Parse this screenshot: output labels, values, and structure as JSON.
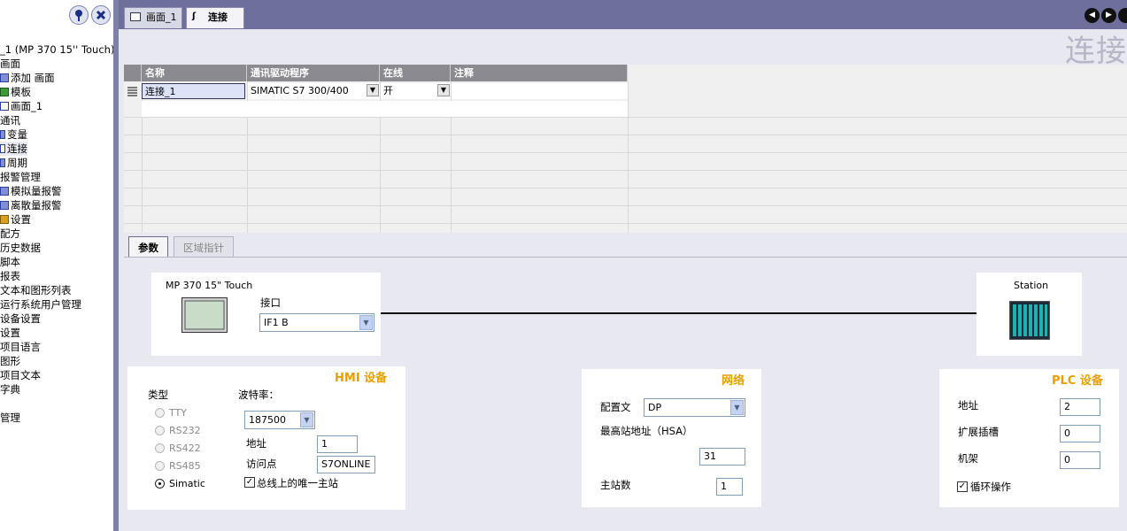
{
  "tree": {
    "root": "_1 (MP 370 15'' Touch)",
    "items": [
      "画面",
      "添加 画面",
      "模板",
      "画面_1",
      "通讯",
      "变量",
      "连接",
      "周期",
      "报警管理",
      "模拟量报警",
      "离散量报警",
      "设置",
      "配方",
      "历史数据",
      "脚本",
      "报表",
      "文本和图形列表",
      "运行系统用户管理",
      "设备设置",
      "设置",
      "项目语言",
      "图形",
      "项目文本",
      "字典",
      "",
      "管理"
    ]
  },
  "tabs": [
    {
      "label": "画面_1",
      "active": false
    },
    {
      "label": "连接",
      "active": true
    }
  ],
  "big_title": "连接",
  "table": {
    "headers": [
      "名称",
      "通讯驱动程序",
      "在线",
      "注释"
    ],
    "row": {
      "name": "连接_1",
      "driver": "SIMATIC S7 300/400",
      "online": "开",
      "comment": ""
    }
  },
  "bottom_tabs": [
    {
      "label": "参数",
      "active": true
    },
    {
      "label": "区域指针",
      "active": false
    }
  ],
  "device": {
    "name": "MP 370 15\" Touch",
    "interface_label": "接口",
    "interface_value": "IF1 B",
    "station_label": "Station"
  },
  "hmi": {
    "title": "HMI 设备",
    "type_label": "类型",
    "types": [
      {
        "label": "TTY",
        "selected": false
      },
      {
        "label": "RS232",
        "selected": false
      },
      {
        "label": "RS422",
        "selected": false
      },
      {
        "label": "RS485",
        "selected": false
      },
      {
        "label": "Simatic",
        "selected": true
      }
    ],
    "baud_label": "波特率：",
    "baud_value": "187500",
    "address_label": "地址",
    "address_value": "1",
    "access_label": "访问点",
    "access_value": "S7ONLINE",
    "only_master_label": "总线上的唯一主站",
    "only_master_checked": true
  },
  "network": {
    "title": "网络",
    "profile_label": "配置文",
    "profile_value": "DP",
    "hsa_label": "最高站地址（HSA）",
    "hsa_value": "31",
    "masters_label": "主站数",
    "masters_value": "1"
  },
  "plc": {
    "title": "PLC 设备",
    "address_label": "地址",
    "address_value": "2",
    "slot_label": "扩展插槽",
    "slot_value": "0",
    "rack_label": "机架",
    "rack_value": "0",
    "cyclic_label": "循环操作",
    "cyclic_checked": true
  }
}
